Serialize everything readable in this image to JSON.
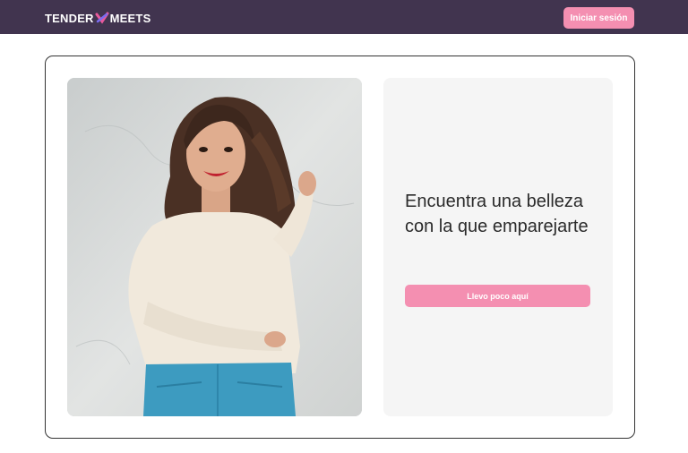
{
  "header": {
    "logo_left": "TENDER",
    "logo_right": "MEETS",
    "login_label": "Iniciar sesión"
  },
  "hero": {
    "photo_alt": "Mujer sonriente con suéter blanco",
    "headline": "Encuentra una belleza con la que emparejarte",
    "cta_label": "Llevo poco aquí"
  },
  "colors": {
    "header_bg": "#41344f",
    "accent": "#f48fb1",
    "panel_bg": "#f5f5f5"
  }
}
